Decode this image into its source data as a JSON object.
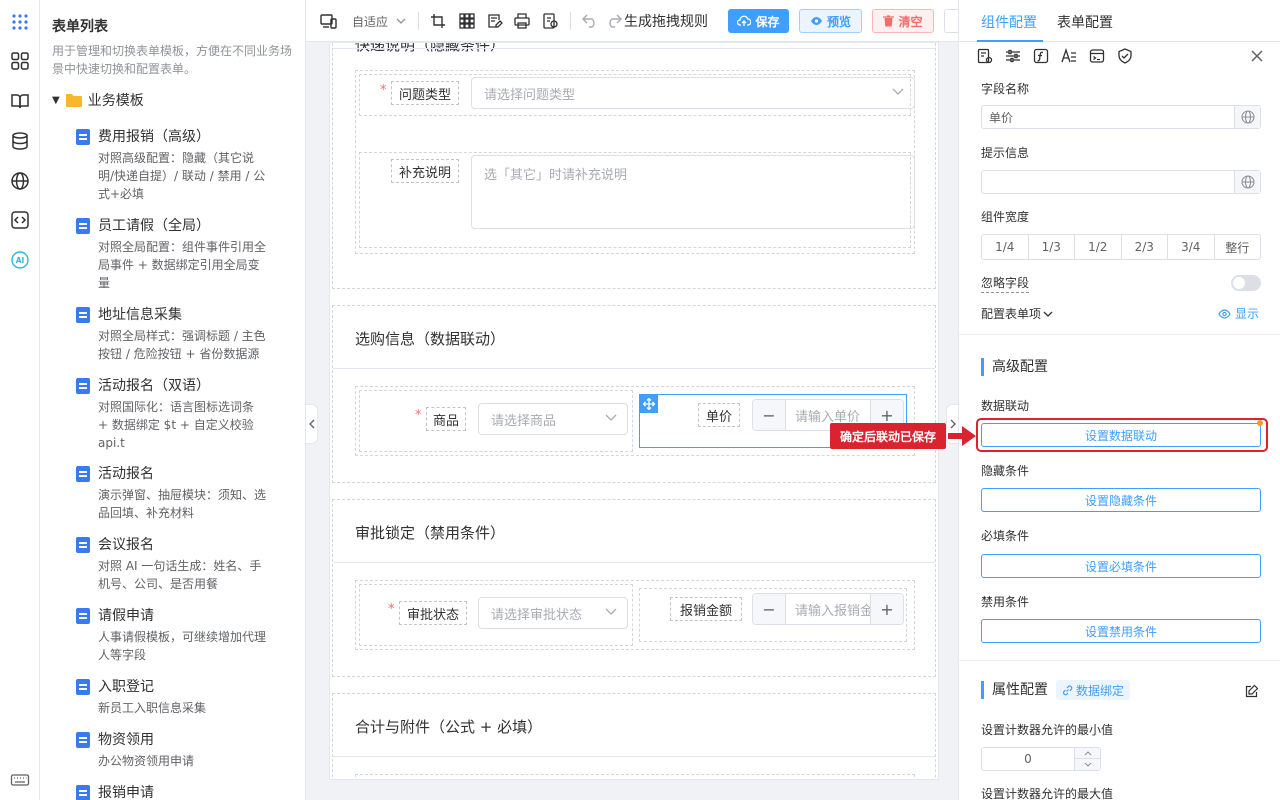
{
  "list": {
    "title": "表单列表",
    "description": "用于管理和切换表单模板，方便在不同业务场景中快速切换和配置表单。",
    "folder": "业务模板",
    "items": [
      {
        "name": "费用报销（高级）",
        "desc": "对照高级配置：隐藏（其它说明/快递自提）/ 联动 / 禁用 / 公式+必填"
      },
      {
        "name": "员工请假（全局）",
        "desc": "对照全局配置：组件事件引用全局事件 + 数据绑定引用全局变量"
      },
      {
        "name": "地址信息采集",
        "desc": "对照全局样式：强调标题 / 主色按钮 / 危险按钮 + 省份数据源"
      },
      {
        "name": "活动报名（双语）",
        "desc": "对照国际化：语言图标选词条 + 数据绑定 $t + 自定义校验 api.t"
      },
      {
        "name": "活动报名",
        "desc": "演示弹窗、抽屉模块：须知、选品回填、补充材料"
      },
      {
        "name": "会议报名",
        "desc": "对照 AI 一句话生成：姓名、手机号、公司、是否用餐"
      },
      {
        "name": "请假申请",
        "desc": "人事请假模板，可继续增加代理人等字段"
      },
      {
        "name": "入职登记",
        "desc": "新员工入职信息采集"
      },
      {
        "name": "物资领用",
        "desc": "办公物资领用申请"
      },
      {
        "name": "报销申请",
        "desc": ""
      }
    ]
  },
  "toolbar": {
    "adapt": "自适应",
    "rule": "生成拖拽规则",
    "save": "保存",
    "preview": "预览",
    "clear": "清空"
  },
  "canvas": {
    "top_section_title": "快递说明（隐藏条件）",
    "problem_type_label": "问题类型",
    "problem_type_placeholder": "请选择问题类型",
    "extra_label": "补充说明",
    "extra_placeholder": "选「其它」时请补充说明",
    "section_purchase": "选购信息（数据联动）",
    "goods_label": "商品",
    "goods_placeholder": "请选择商品",
    "price_label": "单价",
    "price_placeholder": "请输入单价",
    "section_approval": "审批锁定（禁用条件）",
    "approval_label": "审批状态",
    "approval_placeholder": "请选择审批状态",
    "amount_label": "报销金额",
    "amount_placeholder": "请输入报销金额",
    "section_total": "合计与附件（公式 + 必填）",
    "required_mark": "*",
    "minus": "−",
    "plus": "+"
  },
  "panel": {
    "tab_component": "组件配置",
    "tab_form": "表单配置",
    "field_name_label": "字段名称",
    "field_name_value": "单价",
    "hint_label": "提示信息",
    "hint_value": "",
    "width_label": "组件宽度",
    "widths": [
      "1/4",
      "1/3",
      "1/2",
      "2/3",
      "3/4",
      "整行"
    ],
    "ignore_label": "忽略字段",
    "config_items_label": "配置表单项",
    "show_label": "显示",
    "advanced_title": "高级配置",
    "linkage_label": "数据联动",
    "linkage_btn": "设置数据联动",
    "hidden_label": "隐藏条件",
    "hidden_btn": "设置隐藏条件",
    "required_label": "必填条件",
    "required_btn": "设置必填条件",
    "disabled_label": "禁用条件",
    "disabled_btn": "设置禁用条件",
    "props_title": "属性配置",
    "binding_tag": "数据绑定",
    "min_label": "设置计数器允许的最小值",
    "min_value": "0",
    "max_label": "设置计数器允许的最大值",
    "tooltip": "确定后联动已保存"
  },
  "colors": {
    "primary": "#409eff",
    "danger": "#f56c6c",
    "callout": "#d9232f"
  }
}
